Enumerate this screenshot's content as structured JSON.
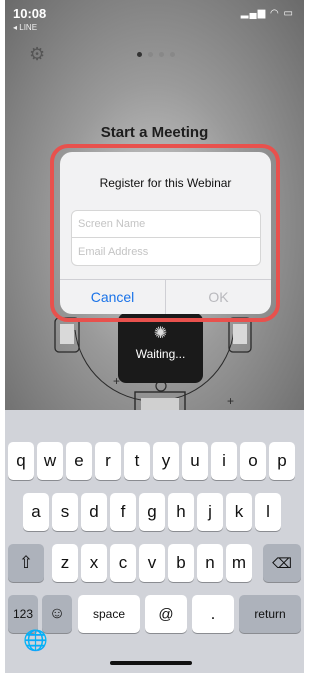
{
  "status_bar": {
    "time": "10:08",
    "back_app": "◂ LINE"
  },
  "meeting": {
    "title": "Start a Meeting"
  },
  "waiting": {
    "label": "Waiting..."
  },
  "dialog": {
    "title": "Register for this Webinar",
    "screen_name_placeholder": "Screen Name",
    "email_placeholder": "Email Address",
    "cancel_label": "Cancel",
    "ok_label": "OK",
    "highlight_color": "#e8514d"
  },
  "keyboard": {
    "row1": [
      "q",
      "w",
      "e",
      "r",
      "t",
      "y",
      "u",
      "i",
      "o",
      "p"
    ],
    "row2": [
      "a",
      "s",
      "d",
      "f",
      "g",
      "h",
      "j",
      "k",
      "l"
    ],
    "row3": [
      "z",
      "x",
      "c",
      "v",
      "b",
      "n",
      "m"
    ],
    "numbers": "123",
    "space": "space",
    "at": "@",
    "dot": ".",
    "return": "return"
  }
}
